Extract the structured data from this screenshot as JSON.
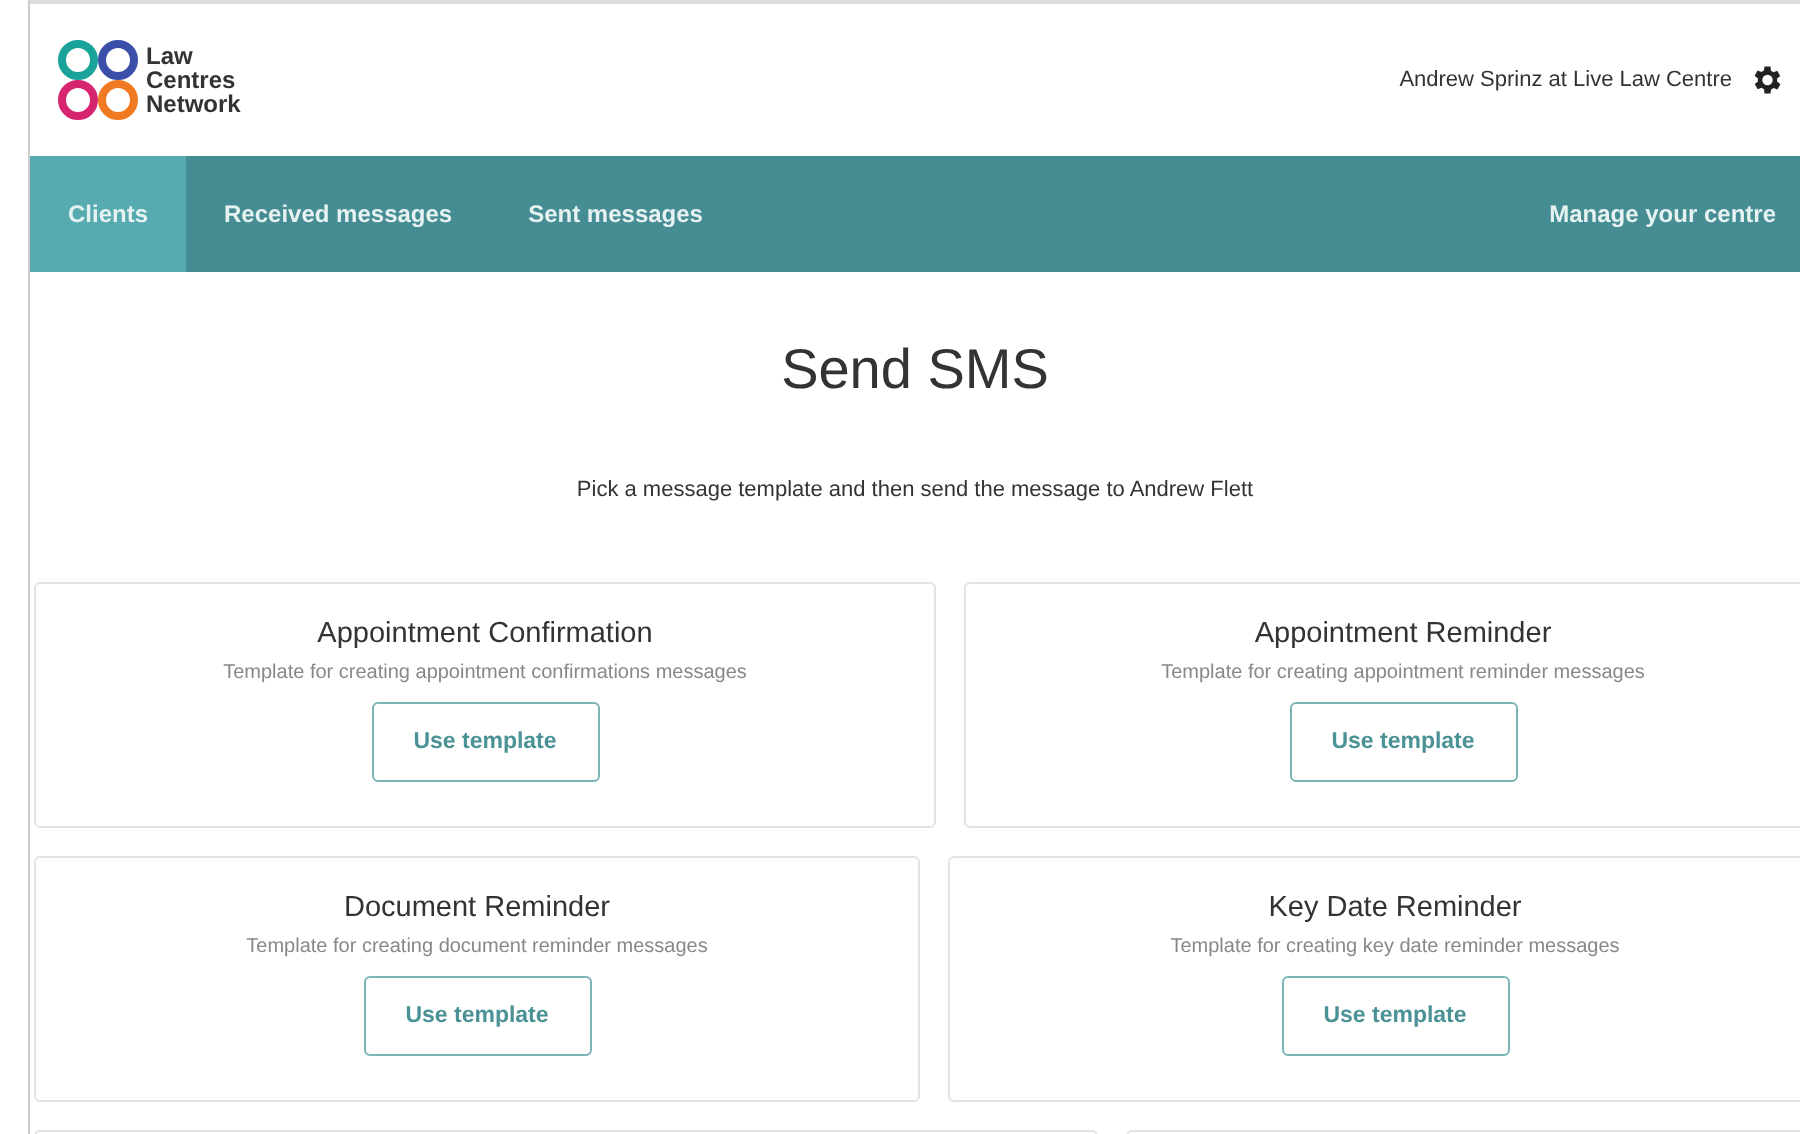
{
  "brand": {
    "name_lines": [
      "Law",
      "Centres",
      "Network"
    ]
  },
  "user": {
    "label": "Andrew Sprinz at Live Law Centre"
  },
  "nav": [
    {
      "label": "Clients",
      "selected": true
    },
    {
      "label": "Received messages",
      "selected": false
    },
    {
      "label": "Sent messages",
      "selected": false
    }
  ],
  "nav_right": {
    "label": "Manage your centre"
  },
  "heading": "Send SMS",
  "subtitle": "Pick a message template and then send the message to Andrew Flett",
  "templates": [
    {
      "title": "Appointment Confirmation",
      "description": "Template for creating appointment confirmations messages",
      "button": "Use template"
    },
    {
      "title": "Appointment Reminder",
      "description": "Template for creating appointment reminder messages",
      "button": "Use template"
    },
    {
      "title": "Document Reminder",
      "description": "Template for creating document reminder messages",
      "button": "Use template"
    },
    {
      "title": "Key Date Reminder",
      "description": "Template for creating key date reminder messages",
      "button": "Use template"
    }
  ]
}
